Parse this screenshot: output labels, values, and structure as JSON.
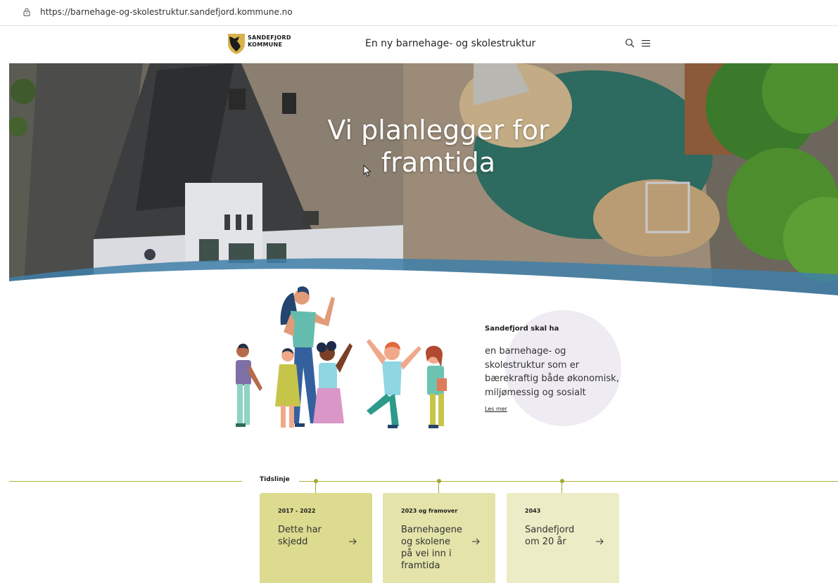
{
  "browser": {
    "url": "https://barnehage-og-skolestruktur.sandefjord.kommune.no"
  },
  "header": {
    "logo_line1": "SANDEFJORD",
    "logo_line2": "KOMMUNE",
    "title": "En ny barnehage- og skolestruktur",
    "icons": [
      "search-icon",
      "menu-icon"
    ]
  },
  "hero": {
    "title_line1": "Vi planlegger for",
    "title_line2": "framtida"
  },
  "intro": {
    "heading": "Sandefjord skal ha",
    "body": "en barnehage- og skolestruktur som er bærekraftig både økonomisk, miljømessig og sosialt",
    "read_more": "Les mer"
  },
  "timeline": {
    "label": "Tidslinje",
    "cards": [
      {
        "period": "2017 - 2022",
        "title": "Dette har skjedd",
        "color": "#dcdb8f"
      },
      {
        "period": "2023 og framover",
        "title": "Barnehagene og skolene på vei inn i framtida",
        "color": "#e3e3aa"
      },
      {
        "period": "2043",
        "title": "Sandefjord om 20 år",
        "color": "#ececc6"
      }
    ]
  },
  "colors": {
    "accent": "#a9b33c",
    "bubble": "#eeebf2",
    "wave": "#3f7fa8"
  }
}
